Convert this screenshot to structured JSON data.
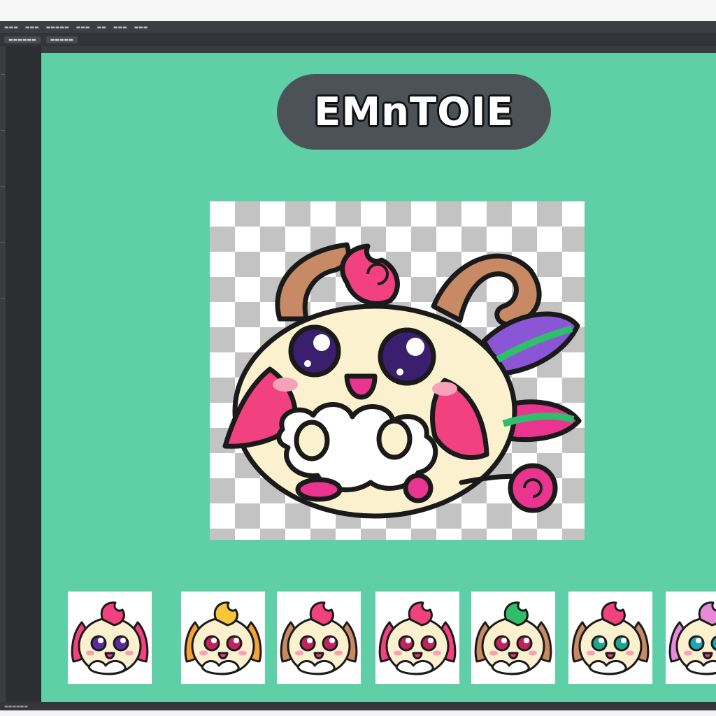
{
  "app": {
    "menu_items": [
      "▬▬▬",
      "▬▬▬",
      "▬▬▬▬▬",
      "▬▬▬",
      "▬▬",
      "▬▬▬",
      "▬▬▬"
    ],
    "tabs": [
      "▬▬▬▬▬▬",
      "▬▬▬▬▬"
    ],
    "status_text": "▬▬▬▬▬▬"
  },
  "canvas": {
    "background_color": "#5ecfa6",
    "title": "EMnTOIE"
  },
  "colors": {
    "outline": "#1a1a1a",
    "cream": "#fbf1cf",
    "pink": "#f2417f",
    "magenta": "#e9358f",
    "horn": "#c78a64",
    "fur": "#ffffff",
    "eye": "#3a1f6e"
  },
  "thumbnails": [
    {
      "name": "pink-floppy-ear-creature",
      "ear_color": "#f2417f",
      "eye_color": "#5b2aa0",
      "accent": "#f2417f"
    },
    {
      "name": "yellow-orange-creature",
      "ear_color": "#f6a23a",
      "eye_color": "#c0245e",
      "accent": "#f7c63a"
    },
    {
      "name": "horned-wing-creature",
      "ear_color": "#c78a64",
      "eye_color": "#c0245e",
      "accent": "#f2417f"
    },
    {
      "name": "pink-leaf-ear-creature",
      "ear_color": "#f2417f",
      "eye_color": "#c0245e",
      "accent": "#f2417f"
    },
    {
      "name": "horned-leaf-creature",
      "ear_color": "#c78a64",
      "eye_color": "#c0245e",
      "accent": "#2fbf6a"
    },
    {
      "name": "teal-eyed-horned-creature",
      "ear_color": "#c78a64",
      "eye_color": "#1aa68e",
      "accent": "#f2417f"
    },
    {
      "name": "pink-curly-hair-creature",
      "ear_color": "#e78ad8",
      "eye_color": "#1aa6b6",
      "accent": "#e78ad8"
    }
  ]
}
